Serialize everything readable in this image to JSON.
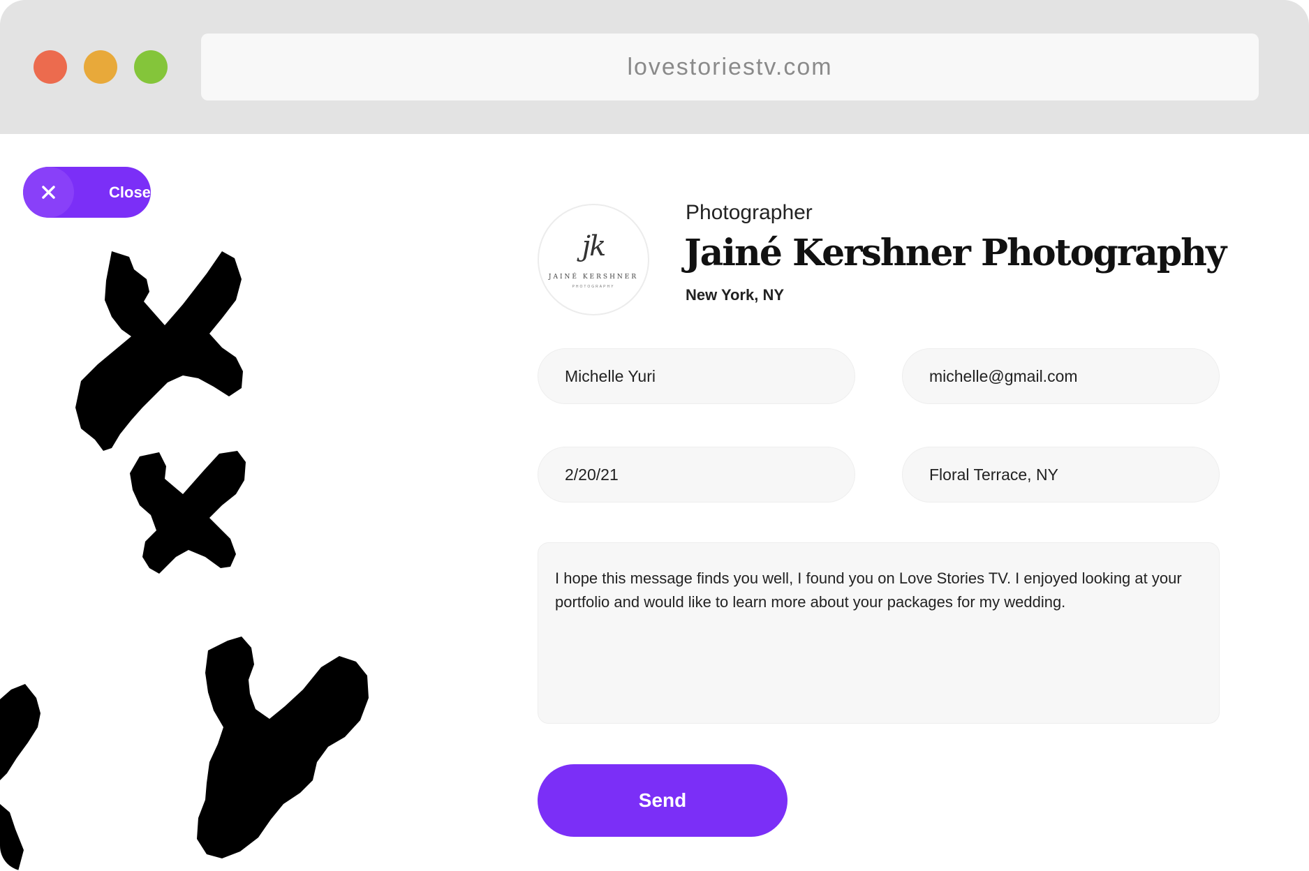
{
  "browser": {
    "url": "lovestoriestv.com",
    "traffic_lights": [
      "#ec6b4e",
      "#e8a93a",
      "#84c53a"
    ]
  },
  "close_button": {
    "label": "Close",
    "color": "#7b2ff7"
  },
  "vendor": {
    "type": "Photographer",
    "name": "Jainé Kershner Photography",
    "location": "New York, NY",
    "logo": {
      "monogram": "jk",
      "name": "JAINÉ KERSHNER",
      "subtitle": "PHOTOGRAPHY"
    }
  },
  "form": {
    "name": "Michelle Yuri",
    "email": "michelle@gmail.com",
    "date": "2/20/21",
    "venue": "Floral Terrace, NY",
    "message": "I hope this message finds you well, I found you on Love Stories TV. I enjoyed looking at your portfolio and would like to learn more about your packages for my wedding.",
    "send_label": "Send",
    "send_color": "#7b2ff7"
  }
}
